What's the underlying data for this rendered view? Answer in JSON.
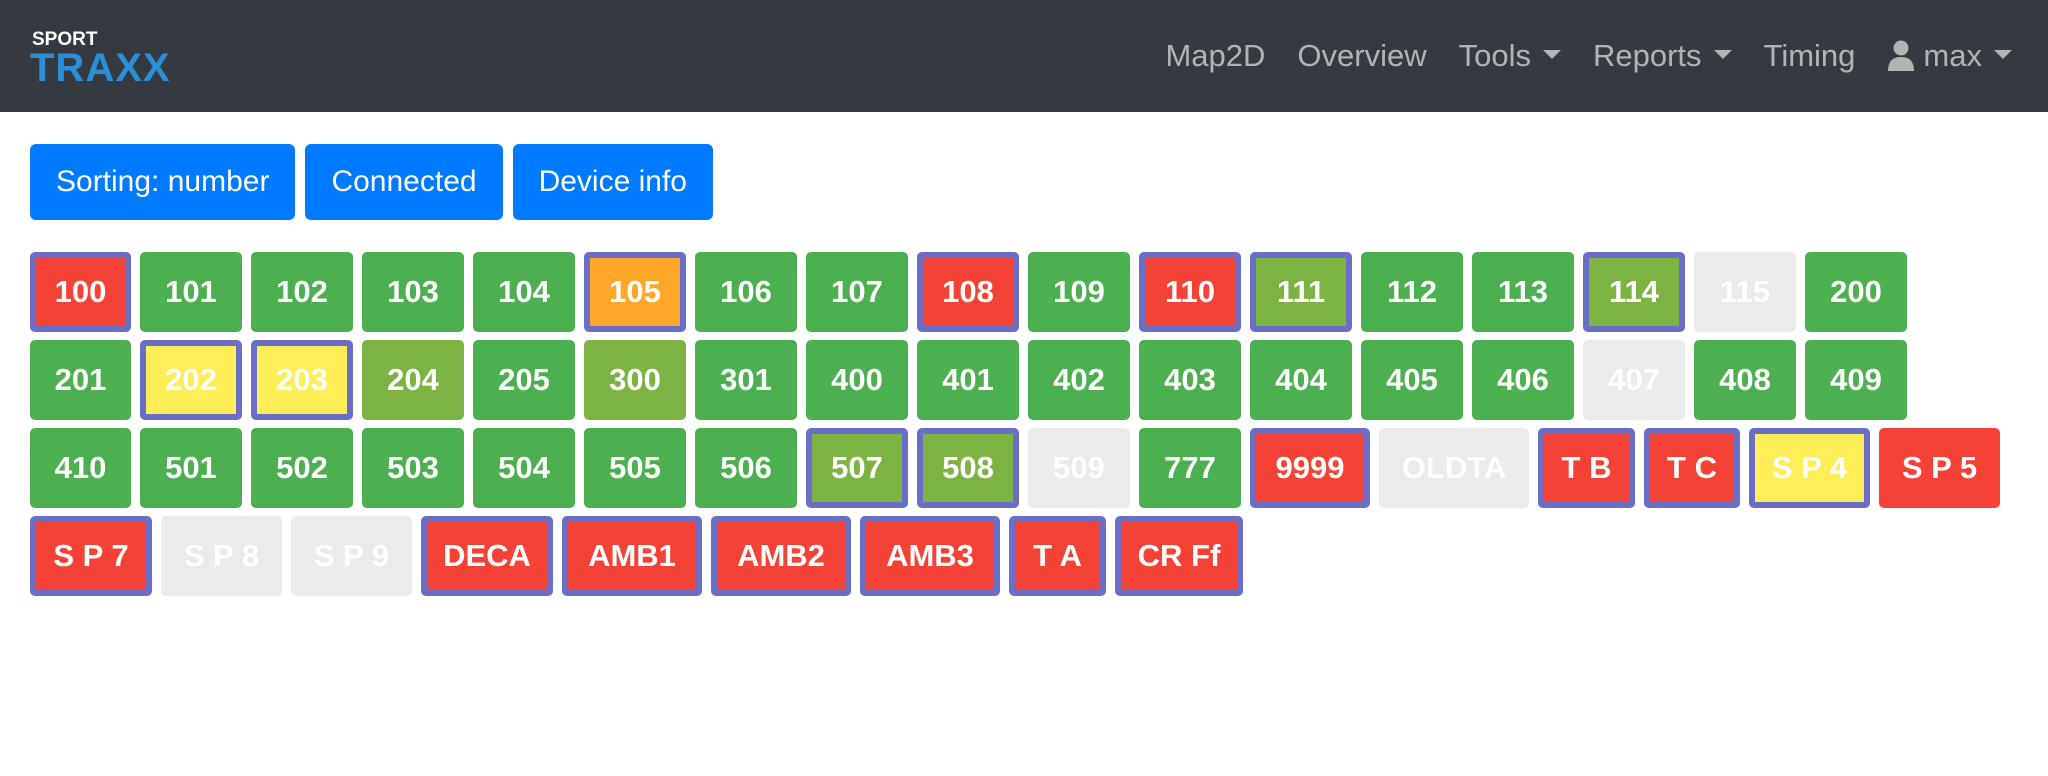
{
  "brand": {
    "top": "SPORT",
    "bottom": "TRAXX"
  },
  "nav": {
    "map2d": "Map2D",
    "overview": "Overview",
    "tools": "Tools",
    "reports": "Reports",
    "timing": "Timing",
    "user": "max"
  },
  "toolbar": {
    "sorting": "Sorting: number",
    "connected": "Connected",
    "device_info": "Device info"
  },
  "colors": {
    "green": "#4caf50",
    "lime": "#7cb342",
    "red": "#f44336",
    "orange": "#ffa726",
    "yellow": "#ffee58",
    "gray": "#ebebeb",
    "ring": "#6a6ec7"
  },
  "devices": [
    [
      {
        "label": "100",
        "color": "red",
        "ring": true
      },
      {
        "label": "101",
        "color": "green",
        "ring": false
      },
      {
        "label": "102",
        "color": "green",
        "ring": false
      },
      {
        "label": "103",
        "color": "green",
        "ring": false
      },
      {
        "label": "104",
        "color": "green",
        "ring": false
      },
      {
        "label": "105",
        "color": "orange",
        "ring": true
      },
      {
        "label": "106",
        "color": "green",
        "ring": false
      },
      {
        "label": "107",
        "color": "green",
        "ring": false
      },
      {
        "label": "108",
        "color": "red",
        "ring": true
      },
      {
        "label": "109",
        "color": "green",
        "ring": false
      },
      {
        "label": "110",
        "color": "red",
        "ring": true
      },
      {
        "label": "111",
        "color": "lime",
        "ring": true
      },
      {
        "label": "112",
        "color": "green",
        "ring": false
      },
      {
        "label": "113",
        "color": "green",
        "ring": false
      },
      {
        "label": "114",
        "color": "lime",
        "ring": true
      },
      {
        "label": "115",
        "color": "gray",
        "ring": false
      },
      {
        "label": "200",
        "color": "green",
        "ring": false
      }
    ],
    [
      {
        "label": "201",
        "color": "green",
        "ring": false
      },
      {
        "label": "202",
        "color": "yellow",
        "ring": true
      },
      {
        "label": "203",
        "color": "yellow",
        "ring": true
      },
      {
        "label": "204",
        "color": "lime",
        "ring": false
      },
      {
        "label": "205",
        "color": "green",
        "ring": false
      },
      {
        "label": "300",
        "color": "lime",
        "ring": false
      },
      {
        "label": "301",
        "color": "green",
        "ring": false
      },
      {
        "label": "400",
        "color": "green",
        "ring": false
      },
      {
        "label": "401",
        "color": "green",
        "ring": false
      },
      {
        "label": "402",
        "color": "green",
        "ring": false
      },
      {
        "label": "403",
        "color": "green",
        "ring": false
      },
      {
        "label": "404",
        "color": "green",
        "ring": false
      },
      {
        "label": "405",
        "color": "green",
        "ring": false
      },
      {
        "label": "406",
        "color": "green",
        "ring": false
      },
      {
        "label": "407",
        "color": "gray",
        "ring": false
      },
      {
        "label": "408",
        "color": "green",
        "ring": false
      },
      {
        "label": "409",
        "color": "green",
        "ring": false
      }
    ],
    [
      {
        "label": "410",
        "color": "green",
        "ring": false
      },
      {
        "label": "501",
        "color": "green",
        "ring": false
      },
      {
        "label": "502",
        "color": "green",
        "ring": false
      },
      {
        "label": "503",
        "color": "green",
        "ring": false
      },
      {
        "label": "504",
        "color": "green",
        "ring": false
      },
      {
        "label": "505",
        "color": "green",
        "ring": false
      },
      {
        "label": "506",
        "color": "green",
        "ring": false
      },
      {
        "label": "507",
        "color": "lime",
        "ring": true
      },
      {
        "label": "508",
        "color": "lime",
        "ring": true
      },
      {
        "label": "509",
        "color": "gray",
        "ring": false
      },
      {
        "label": "777",
        "color": "green",
        "ring": false
      },
      {
        "label": "9999",
        "color": "red",
        "ring": true
      },
      {
        "label": "OLDTA",
        "color": "gray",
        "ring": false
      },
      {
        "label": "T B",
        "color": "red",
        "ring": true
      },
      {
        "label": "T C",
        "color": "red",
        "ring": true
      },
      {
        "label": "S P 4",
        "color": "yellow",
        "ring": true
      },
      {
        "label": "S P 5",
        "color": "red",
        "ring": false
      }
    ],
    [
      {
        "label": "S P 7",
        "color": "red",
        "ring": true
      },
      {
        "label": "S P 8",
        "color": "gray",
        "ring": false
      },
      {
        "label": "S P 9",
        "color": "gray",
        "ring": false
      },
      {
        "label": "DECA",
        "color": "red",
        "ring": true
      },
      {
        "label": "AMB1",
        "color": "red",
        "ring": true
      },
      {
        "label": "AMB2",
        "color": "red",
        "ring": true
      },
      {
        "label": "AMB3",
        "color": "red",
        "ring": true
      },
      {
        "label": "T A",
        "color": "red",
        "ring": true
      },
      {
        "label": "CR Ff",
        "color": "red",
        "ring": true
      }
    ]
  ]
}
